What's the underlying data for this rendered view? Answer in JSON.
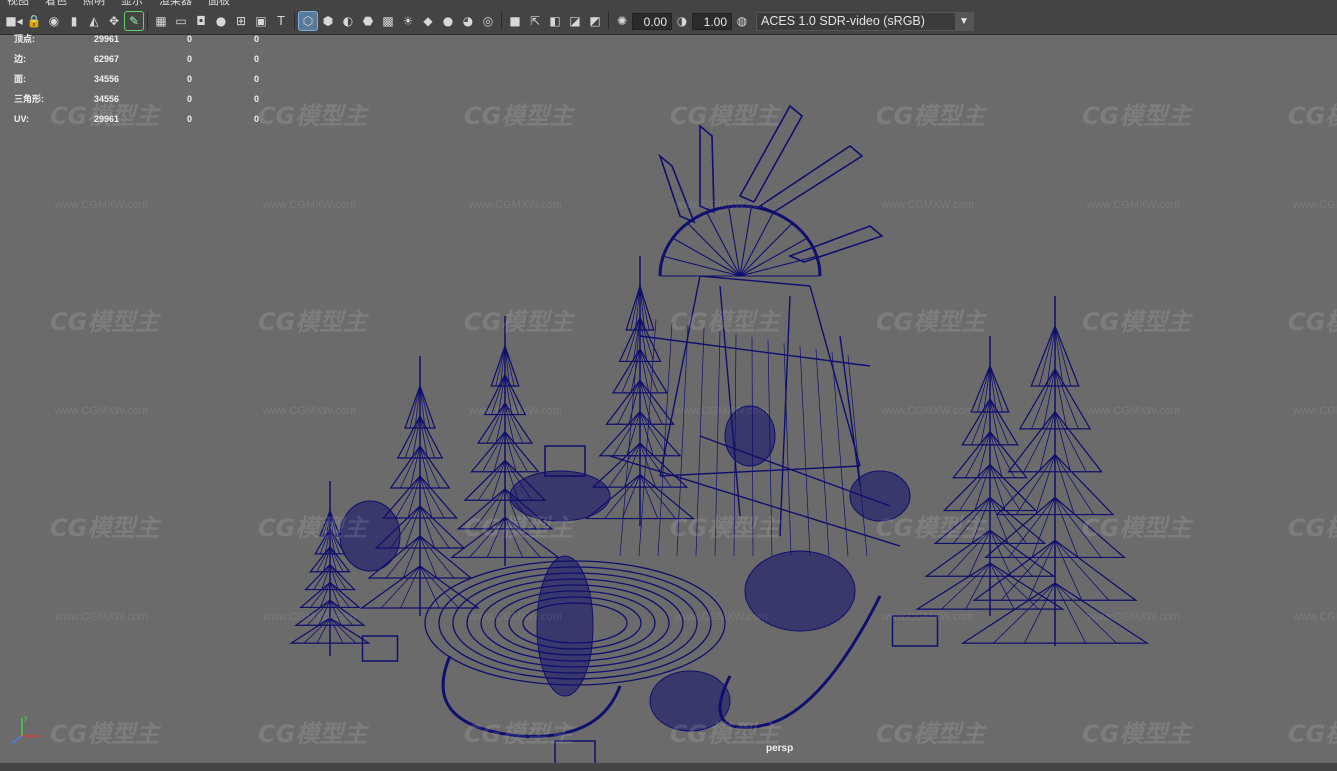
{
  "menu": [
    "视图",
    "着色",
    "照明",
    "显示",
    "渲染器",
    "面板"
  ],
  "toolbar": {
    "icons": [
      {
        "name": "camera-select-icon",
        "glyph": "■◂"
      },
      {
        "name": "camera-lock-icon",
        "glyph": "🔒"
      },
      {
        "name": "camera-attributes-icon",
        "glyph": "◉"
      },
      {
        "name": "bookmark-icon",
        "glyph": "▮"
      },
      {
        "name": "image-plane-icon",
        "glyph": "◭"
      },
      {
        "name": "2d-pan-zoom-icon",
        "glyph": "✥"
      },
      {
        "name": "grease-pencil-icon",
        "glyph": "✎",
        "highlight": "green"
      },
      {
        "name": "grid-icon",
        "glyph": "▦"
      },
      {
        "name": "film-gate-icon",
        "glyph": "▭"
      },
      {
        "name": "resolution-gate-icon",
        "glyph": "◘"
      },
      {
        "name": "gate-mask-icon",
        "glyph": "●"
      },
      {
        "name": "field-chart-icon",
        "glyph": "⊞"
      },
      {
        "name": "safe-action-icon",
        "glyph": "▣"
      },
      {
        "name": "safe-title-icon",
        "glyph": "T"
      },
      {
        "name": "wireframe-icon",
        "glyph": "⬡",
        "active": true
      },
      {
        "name": "smooth-shade-icon",
        "glyph": "⬢"
      },
      {
        "name": "default-material-icon",
        "glyph": "◐"
      },
      {
        "name": "wireframe-on-shaded-icon",
        "glyph": "⬣"
      },
      {
        "name": "textured-icon",
        "glyph": "▩"
      },
      {
        "name": "use-all-lights-icon",
        "glyph": "☀"
      },
      {
        "name": "shadows-icon",
        "glyph": "◆"
      },
      {
        "name": "screen-space-ao-icon",
        "glyph": "●"
      },
      {
        "name": "motion-blur-icon",
        "glyph": "◕"
      },
      {
        "name": "anti-aliasing-icon",
        "glyph": "◎"
      },
      {
        "name": "depth-of-field-icon",
        "glyph": "■"
      },
      {
        "name": "isolate-select-icon",
        "glyph": "⇱"
      },
      {
        "name": "xray-icon",
        "glyph": "◧"
      },
      {
        "name": "xray-joints-icon",
        "glyph": "◪"
      },
      {
        "name": "xray-active-icon",
        "glyph": "◩"
      },
      {
        "name": "exposure-icon",
        "glyph": "✺"
      },
      {
        "name": "gamma-icon",
        "glyph": "◑"
      },
      {
        "name": "color-management-icon",
        "glyph": "◍"
      }
    ],
    "exposure_value": "0.00",
    "gamma_value": "1.00",
    "view_transform": "ACES 1.0 SDR-video (sRGB)"
  },
  "hud": {
    "rows": [
      {
        "label": "顶点:",
        "value": "29961",
        "z1": "0",
        "z2": "0"
      },
      {
        "label": "边:",
        "value": "62967",
        "z1": "0",
        "z2": "0"
      },
      {
        "label": "面:",
        "value": "34556",
        "z1": "0",
        "z2": "0"
      },
      {
        "label": "三角形:",
        "value": "34556",
        "z1": "0",
        "z2": "0"
      },
      {
        "label": "UV:",
        "value": "29961",
        "z1": "0",
        "z2": "0"
      }
    ]
  },
  "viewport": {
    "camera_label": "persp",
    "watermark_logo": "CG模型主",
    "watermark_url": "www.CGMXW.com",
    "wire_color": "#0f0f6e",
    "background_color": "#6b6b6b"
  },
  "axis": {
    "x": "x",
    "y": "y",
    "z": "z"
  }
}
